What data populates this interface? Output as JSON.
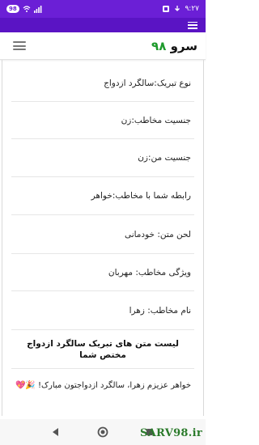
{
  "status_bar": {
    "time": "۹:۲۷",
    "battery": "98",
    "bg_color": "#6b1fd6"
  },
  "header": {
    "logo_text": "سرو",
    "logo_number": "۹۸",
    "logo_number_color": "#1e9a2c"
  },
  "form_rows": [
    {
      "label": "نوع تبریک:سالگرد ازدواج"
    },
    {
      "label": "جنسیت مخاطب:زن"
    },
    {
      "label": "جنسیت من:زن"
    },
    {
      "label": "رابطه شما با مخاطب:خواهر"
    },
    {
      "label": "لحن متن: خودمانی"
    },
    {
      "label": "ویژگی مخاطب: مهربان"
    },
    {
      "label": "نام مخاطب: زهرا"
    }
  ],
  "results_heading": "لیست متن های تبریک سالگرد ازدواج مختص شما",
  "result_message": "خواهر عزیزم زهرا، سالگرد ازدواجتون مبارک! 🎉💖",
  "watermark": "SARV98.ir",
  "nav_icons": [
    "back-triangle",
    "home-circle",
    "recents-square"
  ]
}
